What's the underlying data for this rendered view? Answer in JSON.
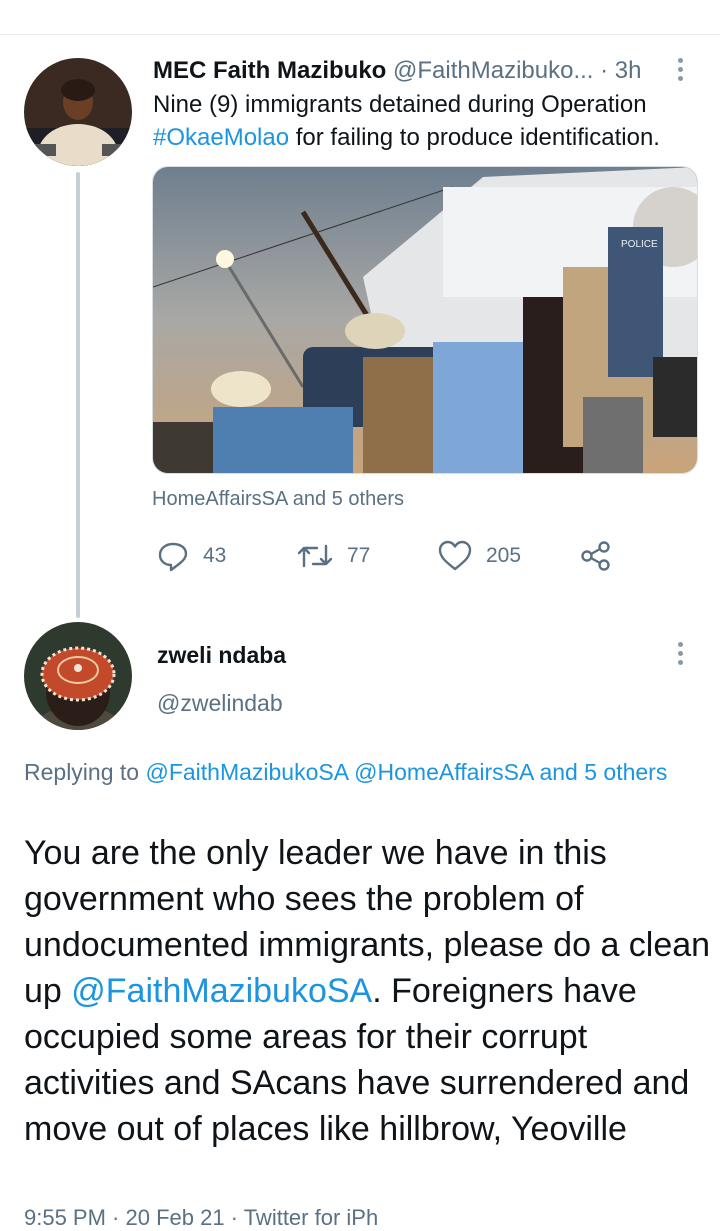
{
  "tweet": {
    "display_name": "MEC Faith Mazibuko",
    "handle": "@FaithMazibuko...",
    "separator": " · ",
    "time": "3h",
    "text_before": "Nine (9) immigrants detained during Operation ",
    "hashtag": "#OkaeMolao",
    "text_after": " for failing to produce identification.",
    "media_sign": "POLICE",
    "liked_by": "HomeAffairsSA and 5 others",
    "replies": "43",
    "retweets": "77",
    "likes": "205"
  },
  "reply": {
    "display_name": "zweli ndaba",
    "handle": "@zwelindab",
    "replying_label": "Replying to ",
    "replying_mentions": "@FaithMazibukoSA @HomeAffairsSA and 5 others",
    "body_before": "You are the only leader we have in this government who sees the problem of undocumented immigrants, please do a clean up ",
    "body_mention": "@FaithMazibukoSA",
    "body_after": ". Foreigners have occupied some areas for their corrupt activities and SAcans have surrendered and move out of places like hillbrow, Yeoville",
    "meta_partial": "9:55 PM · 20 Feb 21 · Twitter for iPh"
  },
  "colors": {
    "link": "#1b95e0",
    "secondary_text": "#5b7083",
    "thread_line": "#c4cfd6"
  },
  "icons": [
    "reply-icon",
    "retweet-icon",
    "like-icon",
    "share-icon",
    "more-options-icon"
  ]
}
